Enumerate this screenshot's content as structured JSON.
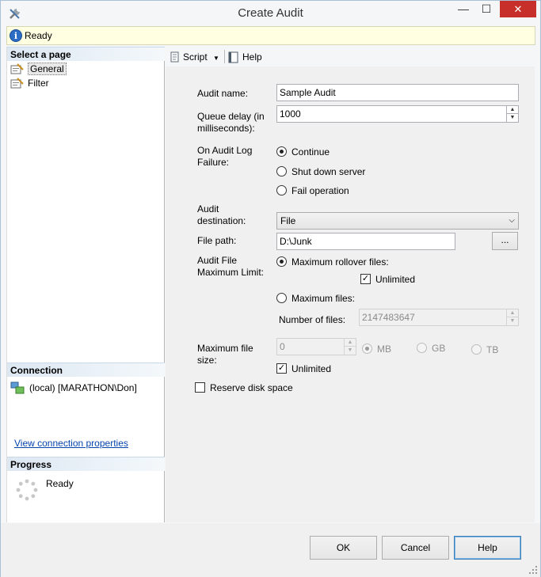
{
  "window": {
    "title": "Create Audit",
    "minimize": "—",
    "maximize": "☐",
    "close": "✕"
  },
  "status": {
    "text": "Ready"
  },
  "left": {
    "select_page_header": "Select a page",
    "pages": [
      {
        "label": "General"
      },
      {
        "label": "Filter"
      }
    ],
    "connection_header": "Connection",
    "connection_text": "(local) [MARATHON\\Don]",
    "view_connection_link": "View connection properties",
    "progress_header": "Progress",
    "progress_status": "Ready"
  },
  "toolbar": {
    "script_label": "Script",
    "help_label": "Help"
  },
  "form": {
    "audit_name_label": "Audit name:",
    "audit_name_value": "Sample Audit",
    "queue_delay_label_1": "Queue delay (in",
    "queue_delay_label_2": "milliseconds):",
    "queue_delay_value": "1000",
    "on_failure_label_1": "On Audit Log",
    "on_failure_label_2": "Failure:",
    "on_failure_options": [
      {
        "label": "Continue",
        "selected": true
      },
      {
        "label": "Shut down server",
        "selected": false
      },
      {
        "label": "Fail operation",
        "selected": false
      }
    ],
    "destination_label_1": "Audit",
    "destination_label_2": "destination:",
    "destination_value": "File",
    "file_path_label": "File path:",
    "file_path_value": "D:\\Junk",
    "browse_label": "...",
    "max_limit_label_1": "Audit File",
    "max_limit_label_2": "Maximum Limit:",
    "max_rollover_label": "Maximum rollover files:",
    "max_rollover_selected": true,
    "rollover_unlimited_label": "Unlimited",
    "rollover_unlimited_checked": true,
    "max_files_label": "Maximum files:",
    "max_files_selected": false,
    "number_of_files_label": "Number of files:",
    "number_of_files_value": "2147483647",
    "max_file_size_label_1": "Maximum file",
    "max_file_size_label_2": "size:",
    "max_file_size_value": "0",
    "size_units": [
      {
        "label": "MB",
        "selected": true
      },
      {
        "label": "GB",
        "selected": false
      },
      {
        "label": "TB",
        "selected": false
      }
    ],
    "size_unlimited_label": "Unlimited",
    "size_unlimited_checked": true,
    "reserve_disk_label": "Reserve disk space",
    "reserve_disk_checked": false
  },
  "buttons": {
    "ok": "OK",
    "cancel": "Cancel",
    "help": "Help"
  },
  "colors": {
    "status_bg": "#ffffe1",
    "accent": "#3c7fb1",
    "link": "#0645ad",
    "close_red": "#c7302a"
  },
  "icons": {
    "app": "tools-icon",
    "info": "info-icon",
    "page": "properties-page-icon",
    "connection": "server-connection-icon",
    "script": "script-icon",
    "help": "help-icon",
    "progress": "spinner-icon"
  }
}
